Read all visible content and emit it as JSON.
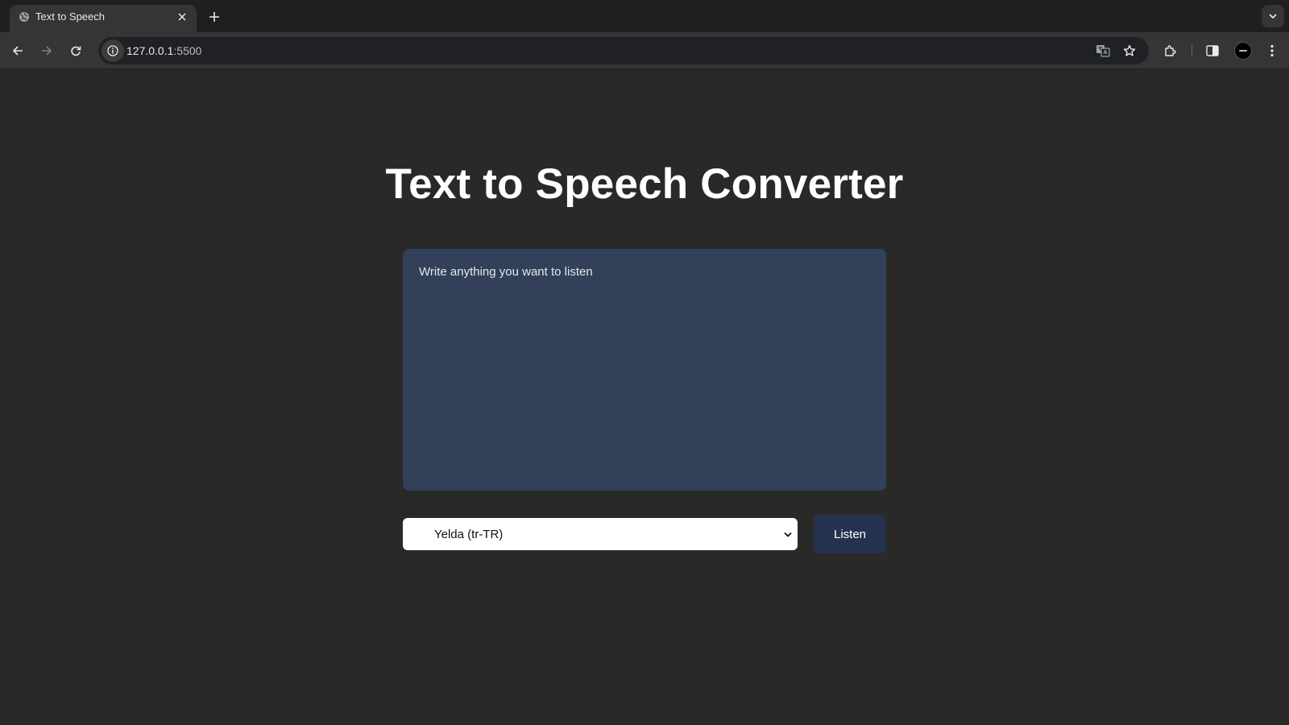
{
  "browser": {
    "tab_title": "Text to Speech",
    "url_host": "127.0.0.1",
    "url_port": ":5500"
  },
  "page": {
    "heading": "Text to Speech Converter",
    "textarea_placeholder": "Write anything you want to listen",
    "textarea_value": "",
    "voice_selected": "Yelda (tr-TR)",
    "listen_label": "Listen"
  },
  "colors": {
    "page_background": "#292928",
    "textarea_background": "#334059",
    "button_background": "#25324d"
  }
}
